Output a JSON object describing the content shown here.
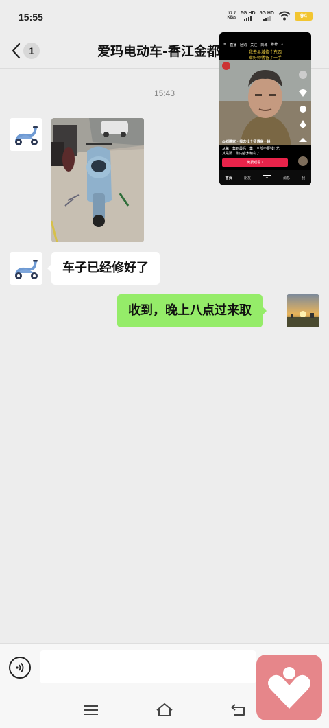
{
  "status_bar": {
    "time": "15:55",
    "net_speed_value": "17.7",
    "net_speed_unit": "KB/s",
    "sim1_label": "5G HD",
    "sim2_label": "5G HD",
    "battery": "94"
  },
  "header": {
    "unread_count": "1",
    "title": "爱玛电动车-香江金都..."
  },
  "messages": {
    "timestamp": "15:43",
    "text_in": "车子已经修好了",
    "text_out": "收到，晚上八点过来取"
  },
  "pip_video": {
    "tabs": [
      "直播",
      "团购",
      "关注",
      "商城",
      "推荐"
    ],
    "active_tab": "推荐",
    "caption_line1": "我去县城修个东西",
    "caption_line2": "幸好师傅留了一手",
    "author": "@邓腾家 · 我去找个师傅家一趟",
    "desc_line1": "从第一集到最后一集，全部不要钱! 尤",
    "desc_line2": "其是那二集内容太精彩了",
    "cta": "免费观看 ›",
    "nav": [
      "首页",
      "朋友",
      "消息",
      "我"
    ]
  },
  "input": {
    "placeholder": ""
  },
  "colors": {
    "outgoing_bubble": "#95ec69",
    "incoming_bubble": "#ffffff",
    "chat_background": "#ededed",
    "battery": "#f2c530",
    "health_app": "#e6868a"
  },
  "icons": {
    "back": "chevron-left-icon",
    "voice": "voice-input-icon",
    "menu": "menu-icon",
    "home": "home-icon",
    "back_nav": "back-arrow-icon",
    "wifi": "wifi-icon",
    "health": "heart-person-icon"
  }
}
